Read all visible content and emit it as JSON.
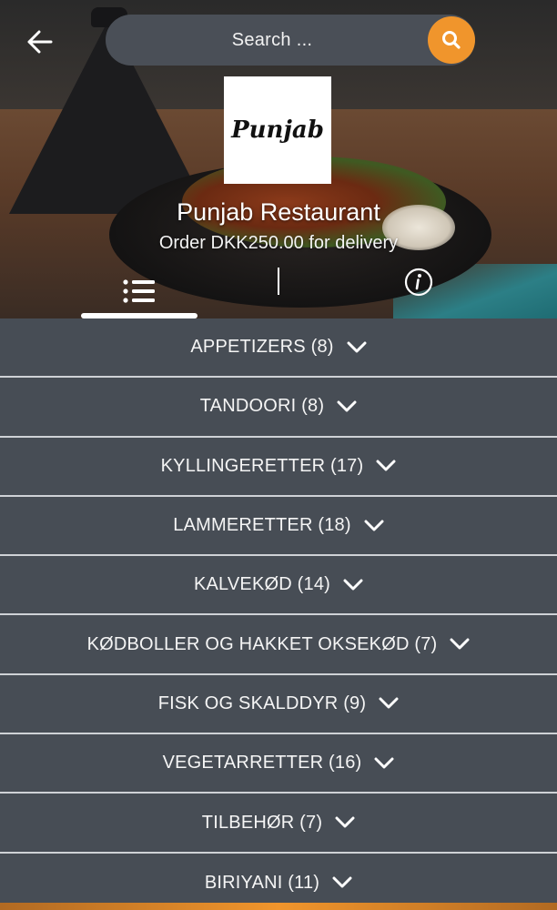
{
  "header": {
    "search_placeholder": "Search ...",
    "icons": {
      "back": "arrow-left-icon",
      "search": "search-icon"
    }
  },
  "restaurant": {
    "logo_text": "Punjab",
    "name": "Punjab Restaurant",
    "subtitle": "Order DKK250.00 for delivery"
  },
  "tabs": {
    "menu_icon": "list-icon",
    "info_icon": "info-icon",
    "active": "menu"
  },
  "categories": [
    {
      "label": "APPETIZERS (8)"
    },
    {
      "label": "TANDOORI (8)"
    },
    {
      "label": "KYLLINGERETTER (17)"
    },
    {
      "label": "LAMMERETTER (18)"
    },
    {
      "label": "KALVEKØD (14)"
    },
    {
      "label": "KØDBOLLER OG HAKKET OKSEKØD (7)"
    },
    {
      "label": "FISK OG SKALDDYR (9)"
    },
    {
      "label": "VEGETARRETTER (16)"
    },
    {
      "label": "TILBEHØR (7)"
    },
    {
      "label": "BIRIYANI (11)"
    }
  ],
  "colors": {
    "accent": "#f0952c",
    "background": "#474d55",
    "divider": "#cfd2d6",
    "search_bg": "#4a4f57"
  }
}
